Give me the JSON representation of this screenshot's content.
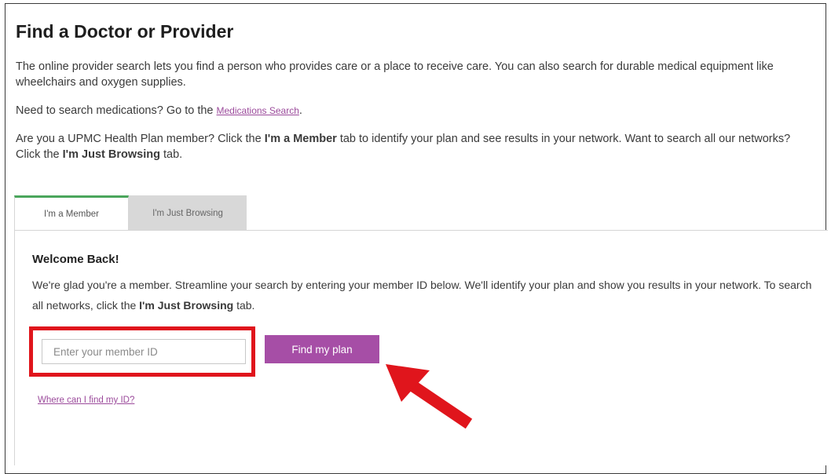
{
  "page": {
    "title": "Find a Doctor or Provider",
    "intro": "The online provider search lets you find a person who provides care or a place to receive care. You can also search for durable medical equipment like wheelchairs and oxygen supplies.",
    "medications": {
      "prefix": "Need to search medications? Go to the ",
      "link_label": "Medications Search",
      "suffix": "."
    },
    "member_note": {
      "part1": "Are you a UPMC Health Plan member? Click the ",
      "bold1": "I'm a Member",
      "part2": " tab to identify your plan and see results in your network. Want to search all our networks? Click the ",
      "bold2": "I'm Just Browsing",
      "part3": " tab."
    }
  },
  "tabs": {
    "member_label": "I'm a Member",
    "browsing_label": "I'm Just Browsing",
    "active": "I'm a Member"
  },
  "panel": {
    "heading": "Welcome Back!",
    "text_part1": "We're glad you're a member. Streamline your search by entering your member ID below. We'll identify your plan and show you results in your network. To search all networks, click the ",
    "text_bold": "I'm Just Browsing",
    "text_part2": " tab.",
    "member_id_placeholder": "Enter your member ID",
    "member_id_value": "",
    "find_button_label": "Find my plan",
    "where_link_label": "Where can I find my ID?"
  },
  "annotations": {
    "highlight_color": "#e0151c",
    "arrow_color": "#e0151c",
    "arrow_icon": "red-arrow-icon"
  },
  "colors": {
    "accent_purple": "#a64ea6",
    "link_purple": "#9b4a9b",
    "tab_active_border": "#4aa55c",
    "tab_inactive_bg": "#d8d8d8"
  }
}
